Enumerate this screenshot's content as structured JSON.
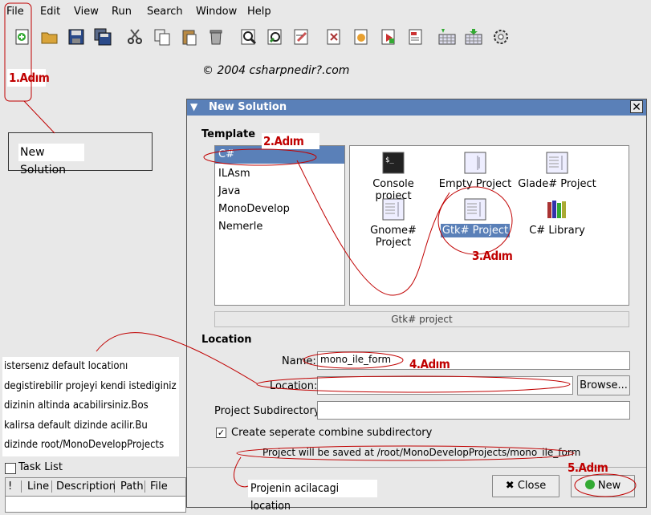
{
  "menu": [
    "File",
    "Edit",
    "View",
    "Run",
    "Search",
    "Window",
    "Help"
  ],
  "watermark": "© 2004 csharpnedir?.com",
  "annotations": {
    "step1": "1.Adım",
    "step2": "2.Adım",
    "step3": "3.Adım",
    "step4": "4.Adım",
    "step5": "5.Adım",
    "new_solution_box": "New Solution",
    "location_note": [
      "istersenız default locationı",
      "degistirebilir projeyi kendi  istediginiz",
      "dizinin altinda acabilirsiniz.Bos",
      "kalirsa default dizinde acilir.Bu",
      "dizinde root/MonoDevelopProjects"
    ],
    "location_caption": "Projenin acilacagi location"
  },
  "dialog": {
    "title": "New Solution",
    "template_label": "Template",
    "languages": [
      "C#",
      "ILAsm",
      "Java",
      "MonoDevelop",
      "Nemerle"
    ],
    "selected_language": "C#",
    "projects": [
      "Console project",
      "Empty Project",
      "Glade# Project",
      "Gnome# Project",
      "Gtk# Project",
      "C# Library"
    ],
    "selected_project": "Gtk# Project",
    "description": "Gtk# project",
    "location_section": "Location",
    "name_label": "Name:",
    "name_value": "mono_ile_form",
    "location_label": "Location:",
    "location_value": "",
    "browse_label": "Browse...",
    "subdir_label": "Project Subdirectory:",
    "subdir_value": "",
    "checkbox_label": "Create seperate combine subdirectory",
    "save_path": "Project will be saved at /root/MonoDevelopProjects/mono_ile_form",
    "close_label": "Close",
    "new_label": "New"
  },
  "tasklist": {
    "title": "Task List",
    "columns": [
      "!",
      "Line",
      "Description",
      "Path",
      "File"
    ]
  },
  "colors": {
    "accent": "#5a80b8",
    "annotation": "#c00000"
  }
}
